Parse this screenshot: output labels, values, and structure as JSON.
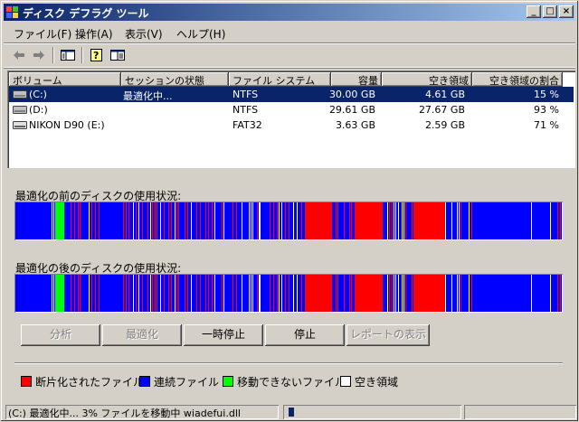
{
  "window": {
    "title": "ディスク デフラグ ツール",
    "controls": {
      "minimize": "_",
      "maximize": "□",
      "close": "×"
    }
  },
  "menu": [
    "ファイル(F)",
    "操作(A)",
    "表示(V)",
    "ヘルプ(H)"
  ],
  "toolbar": {
    "icons": [
      "back-arrow-icon",
      "forward-arrow-icon",
      "console-tree-icon",
      "help-icon",
      "properties-icon"
    ]
  },
  "volumes": {
    "columns": [
      "ボリューム",
      "セッションの状態",
      "ファイル システム",
      "容量",
      "空き領域",
      "空き領域の割合"
    ],
    "rows": [
      {
        "volume": "(C:)",
        "status": "最適化中...",
        "fs": "NTFS",
        "capacity": "30.00 GB",
        "free": "4.61 GB",
        "percent": "15 %",
        "selected": true
      },
      {
        "volume": "(D:)",
        "status": "",
        "fs": "NTFS",
        "capacity": "29.61 GB",
        "free": "27.67 GB",
        "percent": "93 %",
        "selected": false
      },
      {
        "volume": "NIKON D90 (E:)",
        "status": "",
        "fs": "FAT32",
        "capacity": "3.63 GB",
        "free": "2.59 GB",
        "percent": "71 %",
        "selected": false
      }
    ]
  },
  "analysis": {
    "before_label": "最適化の前のディスクの使用状況:",
    "after_label": "最適化の後のディスクの使用状況:"
  },
  "buttons": {
    "analyze": "分析",
    "defragment": "最適化",
    "pause": "一時停止",
    "stop": "停止",
    "report": "レポートの表示"
  },
  "legend": {
    "fragmented": "断片化されたファイル",
    "contiguous": "連続ファイル",
    "unmovable": "移動できないファイル",
    "free": "空き領域"
  },
  "colors": {
    "fragmented": "#ff0000",
    "contiguous": "#0000ff",
    "unmovable": "#00ff00",
    "free": "#ffffff",
    "selection": "#0a246a"
  },
  "status": {
    "text": "(C:) 最適化中... 3%  ファイルを移動中 wiadefui.dll",
    "progress": 0.03
  }
}
